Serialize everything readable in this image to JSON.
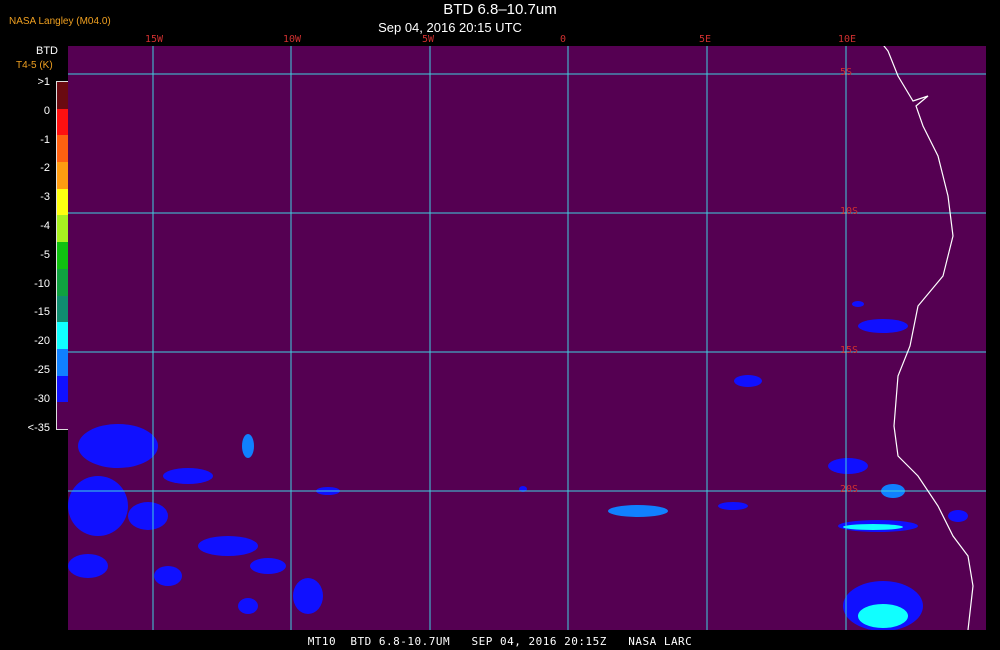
{
  "header": {
    "title": "BTD 6.8–10.7um",
    "subtitle": "Sep 04, 2016 20:15 UTC",
    "source": "NASA Langley (M04.0)"
  },
  "legend": {
    "title": "BTD",
    "subtitle": "T4-5 (K)",
    "labels": [
      ">1",
      "0",
      "-1",
      "-2",
      "-3",
      "-4",
      "-5",
      "-10",
      "-15",
      "-20",
      "-25",
      "-30",
      "<-35"
    ],
    "colors": [
      "#6a0a10",
      "#ff1010",
      "#ff6010",
      "#ff9c10",
      "#ffff10",
      "#a8f020",
      "#10c010",
      "#10a040",
      "#108c70",
      "#10ffff",
      "#1080ff",
      "#1010ff",
      "#550052"
    ]
  },
  "map": {
    "lon_labels": [
      "15W",
      "10W",
      "5W",
      "0",
      "5E",
      "10E"
    ],
    "lat_labels": [
      "5S",
      "10S",
      "15S",
      "20S"
    ],
    "background": "#550052",
    "grid_color": "#40d0e0",
    "coast_color": "#ffffff"
  },
  "footer": {
    "text": "MT10  BTD 6.8-10.7UM   SEP 04, 2016 20:15Z   NASA LARC"
  }
}
